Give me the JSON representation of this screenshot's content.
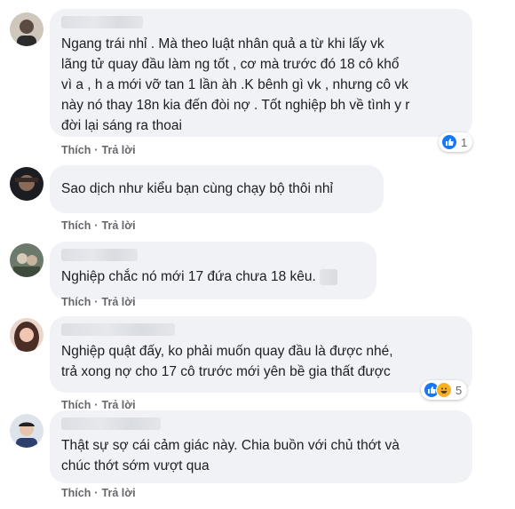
{
  "actions": {
    "like_label": "Thích",
    "reply_label": "Trả lời",
    "separator": "·"
  },
  "comments": [
    {
      "text": "Ngang trái nhỉ . Mà theo luật nhân quả a từ khi lấy vk\nlãng tử quay đầu làm ng tốt , cơ mà trước đó 18 cô khổ\nvì a , h a mới vỡ tan 1 lần àh .K bênh gì vk , nhưng cô vk\nnày nó thay 18n kia đến đòi nợ . Tốt nghiệp bh về tình y r\nđời lại sáng ra thoai",
      "reaction_count": "1"
    },
    {
      "text": "Sao dịch như kiểu bạn cùng chạy bộ thôi nhỉ"
    },
    {
      "text": "Nghiệp chắc nó mới 17 đứa chưa 18 kêu."
    },
    {
      "text": "Nghiệp quật đấy, ko phải muốn quay đầu là được nhé,\ntrả xong nợ cho 17 cô trước mới yên bề gia thất được",
      "reaction_count": "5"
    },
    {
      "text": "Thật sự sợ cái cảm giác này. Chia buồn với chủ thớt và\nchúc thớt sớm vượt qua"
    }
  ]
}
